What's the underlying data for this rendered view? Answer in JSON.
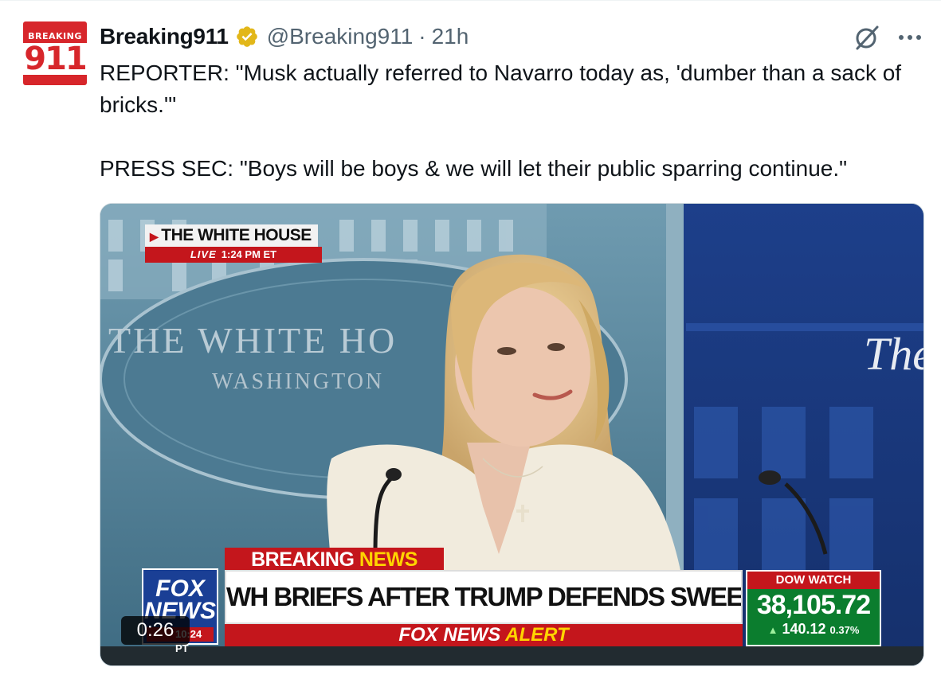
{
  "post": {
    "avatar": {
      "top_text": "BREAKING",
      "number": "911",
      "alt": "Breaking911 logo"
    },
    "display_name": "Breaking911",
    "verified": true,
    "handle": "@Breaking911",
    "separator": "·",
    "time": "21h",
    "text_line_1": "REPORTER: \"Musk actually referred to Navarro today as, 'dumber than a sack of bricks.'\"",
    "text_line_2": "PRESS SEC: \"Boys will be boys & we will let their public sparring continue.\"",
    "icons": {
      "grok": "grok-slash-icon",
      "more": "more-horizontal-icon"
    }
  },
  "video": {
    "duration": "0:26",
    "bug_location": "THE WHITE HOUSE",
    "bug_live": "LIVE",
    "bug_time": "1:24 PM ET",
    "wall_title": "THE WHITE HO",
    "wall_subtitle": "WASHINGTON",
    "wall_right": "The",
    "wall_bottom": "THE WHITE HOUSE",
    "breaking_word": "BREAKING",
    "news_word": "NEWS",
    "headline": "WH BRIEFS AFTER TRUMP DEFENDS SWEEPING TARIFFS",
    "fox_logo_text": "FOX NEWS",
    "fox_logo_time": "10:24 PT",
    "alert_fox": "FOX NEWS",
    "alert_word": "ALERT",
    "dow_label": "DOW WATCH",
    "dow_value": "38,105.72",
    "dow_change": "140.12",
    "dow_percent": "0.37%"
  },
  "colors": {
    "fox_red": "#c4161c",
    "fox_yellow": "#ffd400",
    "dow_green": "#0b7d2e",
    "verified_gold": "#e2b719",
    "secondary_text": "#536471"
  }
}
